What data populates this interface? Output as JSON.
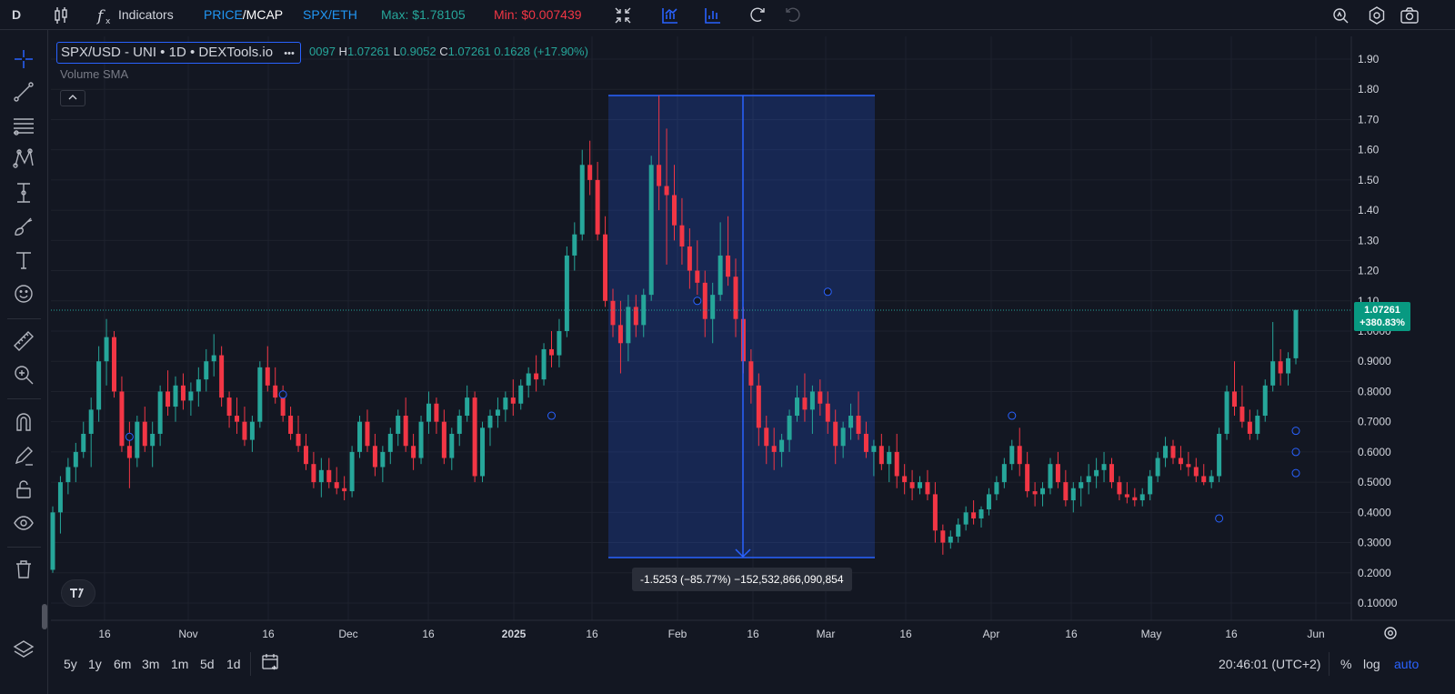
{
  "topbar": {
    "symbol_short": "D",
    "indicators_label": "Indicators",
    "price_label": "PRICE",
    "mcap_label": "/MCAP",
    "pair_label": "SPX/ETH",
    "max_label": "Max: $1.78105",
    "min_label": "Min: $0.007439"
  },
  "legend": {
    "title": "SPX/USD - UNI • 1D • DEXTools.io",
    "more": "•••",
    "ohlc_partial": "0097",
    "h_label": "H",
    "h_value": "1.07261",
    "l_label": "L",
    "l_value": "0.9052",
    "c_label": "C",
    "c_value": "1.07261",
    "change": "0.1628 (+17.90%)",
    "volume_label": "Volume SMA"
  },
  "price_axis": {
    "ticks": [
      "1.90",
      "1.80",
      "1.70",
      "1.60",
      "1.50",
      "1.40",
      "1.30",
      "1.20",
      "1.10",
      "1.0000",
      "0.9000",
      "0.8000",
      "0.7000",
      "0.6000",
      "0.5000",
      "0.4000",
      "0.3000",
      "0.2000",
      "0.10000"
    ],
    "last_price": "1.07261",
    "last_change": "+380.83%"
  },
  "time_axis": {
    "ticks": [
      "16",
      "Nov",
      "16",
      "Dec",
      "16",
      "2025",
      "16",
      "Feb",
      "16",
      "Mar",
      "16",
      "Apr",
      "16",
      "May",
      "16",
      "Jun"
    ]
  },
  "measure": {
    "label": "-1.5253 (−85.77%) −152,532,866,090,854"
  },
  "bottombar": {
    "ranges": [
      "5y",
      "1y",
      "6m",
      "3m",
      "1m",
      "5d",
      "1d"
    ],
    "clock": "20:46:01 (UTC+2)",
    "percent": "%",
    "log": "log",
    "auto": "auto"
  },
  "colors": {
    "up": "#26a69a",
    "down": "#f23645",
    "accent": "#2962ff",
    "background": "#131722"
  },
  "chart_data": {
    "type": "candlestick",
    "title": "SPX/USD - UNI • 1D • DEXTools.io",
    "x_range": [
      "2024-10-10",
      "2025-05-28"
    ],
    "y_range": [
      0.05,
      1.95
    ],
    "last_close": 1.07261,
    "measure": {
      "from": 1.78105,
      "to": 0.2557,
      "change": -1.5253,
      "change_pct": -85.77
    },
    "ohlc": [
      [
        0.21,
        0.42,
        0.2,
        0.4
      ],
      [
        0.4,
        0.52,
        0.33,
        0.5
      ],
      [
        0.5,
        0.58,
        0.46,
        0.55
      ],
      [
        0.55,
        0.63,
        0.5,
        0.6
      ],
      [
        0.6,
        0.7,
        0.58,
        0.66
      ],
      [
        0.66,
        0.78,
        0.55,
        0.74
      ],
      [
        0.74,
        0.95,
        0.7,
        0.9
      ],
      [
        0.9,
        1.04,
        0.82,
        0.98
      ],
      [
        0.98,
        1.0,
        0.78,
        0.8
      ],
      [
        0.8,
        0.85,
        0.6,
        0.62
      ],
      [
        0.62,
        0.7,
        0.48,
        0.58
      ],
      [
        0.58,
        0.72,
        0.55,
        0.7
      ],
      [
        0.7,
        0.75,
        0.6,
        0.62
      ],
      [
        0.62,
        0.7,
        0.55,
        0.66
      ],
      [
        0.66,
        0.82,
        0.62,
        0.8
      ],
      [
        0.8,
        0.87,
        0.72,
        0.75
      ],
      [
        0.75,
        0.85,
        0.7,
        0.82
      ],
      [
        0.82,
        0.86,
        0.74,
        0.77
      ],
      [
        0.77,
        0.83,
        0.72,
        0.8
      ],
      [
        0.8,
        0.88,
        0.75,
        0.84
      ],
      [
        0.84,
        0.94,
        0.8,
        0.9
      ],
      [
        0.9,
        0.99,
        0.85,
        0.92
      ],
      [
        0.92,
        0.95,
        0.75,
        0.78
      ],
      [
        0.78,
        0.8,
        0.68,
        0.72
      ],
      [
        0.72,
        0.78,
        0.66,
        0.7
      ],
      [
        0.7,
        0.75,
        0.62,
        0.64
      ],
      [
        0.64,
        0.72,
        0.6,
        0.7
      ],
      [
        0.7,
        0.9,
        0.68,
        0.88
      ],
      [
        0.88,
        0.95,
        0.8,
        0.82
      ],
      [
        0.82,
        0.88,
        0.76,
        0.78
      ],
      [
        0.78,
        0.82,
        0.7,
        0.72
      ],
      [
        0.72,
        0.75,
        0.64,
        0.66
      ],
      [
        0.66,
        0.72,
        0.6,
        0.62
      ],
      [
        0.62,
        0.66,
        0.54,
        0.56
      ],
      [
        0.56,
        0.6,
        0.48,
        0.5
      ],
      [
        0.5,
        0.58,
        0.45,
        0.54
      ],
      [
        0.54,
        0.58,
        0.48,
        0.5
      ],
      [
        0.5,
        0.55,
        0.46,
        0.48
      ],
      [
        0.48,
        0.52,
        0.44,
        0.47
      ],
      [
        0.47,
        0.62,
        0.45,
        0.6
      ],
      [
        0.6,
        0.72,
        0.58,
        0.7
      ],
      [
        0.7,
        0.74,
        0.6,
        0.62
      ],
      [
        0.62,
        0.66,
        0.52,
        0.55
      ],
      [
        0.55,
        0.62,
        0.5,
        0.6
      ],
      [
        0.6,
        0.68,
        0.56,
        0.66
      ],
      [
        0.66,
        0.74,
        0.62,
        0.72
      ],
      [
        0.72,
        0.78,
        0.6,
        0.62
      ],
      [
        0.62,
        0.66,
        0.54,
        0.58
      ],
      [
        0.58,
        0.72,
        0.56,
        0.7
      ],
      [
        0.7,
        0.8,
        0.66,
        0.76
      ],
      [
        0.76,
        0.78,
        0.66,
        0.7
      ],
      [
        0.7,
        0.74,
        0.56,
        0.58
      ],
      [
        0.58,
        0.68,
        0.54,
        0.66
      ],
      [
        0.66,
        0.74,
        0.62,
        0.72
      ],
      [
        0.72,
        0.82,
        0.7,
        0.78
      ],
      [
        0.78,
        0.8,
        0.5,
        0.52
      ],
      [
        0.52,
        0.7,
        0.5,
        0.68
      ],
      [
        0.68,
        0.74,
        0.62,
        0.72
      ],
      [
        0.72,
        0.78,
        0.68,
        0.74
      ],
      [
        0.74,
        0.8,
        0.7,
        0.78
      ],
      [
        0.78,
        0.84,
        0.72,
        0.76
      ],
      [
        0.76,
        0.84,
        0.74,
        0.82
      ],
      [
        0.82,
        0.88,
        0.78,
        0.86
      ],
      [
        0.86,
        0.92,
        0.8,
        0.84
      ],
      [
        0.84,
        0.96,
        0.82,
        0.94
      ],
      [
        0.94,
        1.0,
        0.88,
        0.92
      ],
      [
        0.92,
        1.04,
        0.88,
        1.0
      ],
      [
        1.0,
        1.28,
        0.98,
        1.25
      ],
      [
        1.25,
        1.36,
        1.2,
        1.32
      ],
      [
        1.32,
        1.6,
        1.3,
        1.55
      ],
      [
        1.55,
        1.63,
        1.45,
        1.5
      ],
      [
        1.5,
        1.56,
        1.3,
        1.32
      ],
      [
        1.32,
        1.38,
        1.08,
        1.1
      ],
      [
        1.1,
        1.14,
        0.98,
        1.02
      ],
      [
        1.02,
        1.1,
        0.86,
        0.96
      ],
      [
        0.96,
        1.12,
        0.9,
        1.08
      ],
      [
        1.08,
        1.12,
        0.98,
        1.02
      ],
      [
        1.02,
        1.14,
        0.98,
        1.12
      ],
      [
        1.12,
        1.58,
        1.1,
        1.55
      ],
      [
        1.55,
        1.78,
        1.4,
        1.48
      ],
      [
        1.48,
        1.67,
        1.22,
        1.45
      ],
      [
        1.45,
        1.55,
        1.3,
        1.35
      ],
      [
        1.35,
        1.44,
        1.22,
        1.28
      ],
      [
        1.28,
        1.34,
        1.14,
        1.2
      ],
      [
        1.2,
        1.3,
        1.12,
        1.16
      ],
      [
        1.16,
        1.2,
        0.98,
        1.04
      ],
      [
        1.04,
        1.16,
        0.96,
        1.12
      ],
      [
        1.12,
        1.36,
        1.1,
        1.25
      ],
      [
        1.25,
        1.38,
        1.15,
        1.18
      ],
      [
        1.18,
        1.24,
        0.98,
        1.04
      ],
      [
        1.04,
        1.08,
        0.86,
        0.9
      ],
      [
        0.9,
        0.94,
        0.76,
        0.82
      ],
      [
        0.82,
        0.86,
        0.62,
        0.68
      ],
      [
        0.68,
        0.72,
        0.56,
        0.62
      ],
      [
        0.62,
        0.68,
        0.54,
        0.6
      ],
      [
        0.6,
        0.66,
        0.55,
        0.64
      ],
      [
        0.64,
        0.74,
        0.6,
        0.72
      ],
      [
        0.72,
        0.82,
        0.7,
        0.78
      ],
      [
        0.78,
        0.86,
        0.7,
        0.74
      ],
      [
        0.74,
        0.82,
        0.66,
        0.8
      ],
      [
        0.8,
        0.84,
        0.72,
        0.76
      ],
      [
        0.76,
        0.8,
        0.66,
        0.7
      ],
      [
        0.7,
        0.74,
        0.56,
        0.62
      ],
      [
        0.62,
        0.7,
        0.58,
        0.68
      ],
      [
        0.68,
        0.76,
        0.64,
        0.72
      ],
      [
        0.72,
        0.8,
        0.64,
        0.66
      ],
      [
        0.66,
        0.7,
        0.58,
        0.6
      ],
      [
        0.6,
        0.64,
        0.52,
        0.62
      ],
      [
        0.62,
        0.66,
        0.54,
        0.56
      ],
      [
        0.56,
        0.62,
        0.5,
        0.6
      ],
      [
        0.6,
        0.66,
        0.48,
        0.52
      ],
      [
        0.52,
        0.56,
        0.46,
        0.5
      ],
      [
        0.5,
        0.54,
        0.44,
        0.48
      ],
      [
        0.48,
        0.52,
        0.46,
        0.5
      ],
      [
        0.5,
        0.54,
        0.44,
        0.46
      ],
      [
        0.46,
        0.5,
        0.3,
        0.34
      ],
      [
        0.34,
        0.36,
        0.26,
        0.3
      ],
      [
        0.3,
        0.34,
        0.28,
        0.32
      ],
      [
        0.32,
        0.38,
        0.3,
        0.36
      ],
      [
        0.36,
        0.42,
        0.34,
        0.4
      ],
      [
        0.4,
        0.44,
        0.36,
        0.38
      ],
      [
        0.38,
        0.42,
        0.35,
        0.41
      ],
      [
        0.41,
        0.48,
        0.39,
        0.46
      ],
      [
        0.46,
        0.52,
        0.44,
        0.5
      ],
      [
        0.5,
        0.58,
        0.48,
        0.56
      ],
      [
        0.56,
        0.64,
        0.54,
        0.62
      ],
      [
        0.62,
        0.68,
        0.52,
        0.56
      ],
      [
        0.56,
        0.6,
        0.45,
        0.47
      ],
      [
        0.47,
        0.5,
        0.42,
        0.46
      ],
      [
        0.46,
        0.5,
        0.42,
        0.48
      ],
      [
        0.48,
        0.58,
        0.46,
        0.56
      ],
      [
        0.56,
        0.6,
        0.48,
        0.5
      ],
      [
        0.5,
        0.54,
        0.42,
        0.44
      ],
      [
        0.44,
        0.5,
        0.4,
        0.48
      ],
      [
        0.48,
        0.52,
        0.42,
        0.5
      ],
      [
        0.5,
        0.56,
        0.46,
        0.52
      ],
      [
        0.52,
        0.58,
        0.48,
        0.54
      ],
      [
        0.54,
        0.6,
        0.5,
        0.56
      ],
      [
        0.56,
        0.58,
        0.48,
        0.5
      ],
      [
        0.5,
        0.52,
        0.44,
        0.46
      ],
      [
        0.46,
        0.5,
        0.43,
        0.45
      ],
      [
        0.45,
        0.48,
        0.42,
        0.44
      ],
      [
        0.44,
        0.48,
        0.42,
        0.46
      ],
      [
        0.46,
        0.54,
        0.44,
        0.52
      ],
      [
        0.52,
        0.6,
        0.5,
        0.58
      ],
      [
        0.58,
        0.65,
        0.55,
        0.62
      ],
      [
        0.62,
        0.64,
        0.56,
        0.58
      ],
      [
        0.58,
        0.62,
        0.54,
        0.56
      ],
      [
        0.56,
        0.6,
        0.52,
        0.55
      ],
      [
        0.55,
        0.58,
        0.5,
        0.52
      ],
      [
        0.52,
        0.56,
        0.49,
        0.5
      ],
      [
        0.5,
        0.54,
        0.48,
        0.52
      ],
      [
        0.52,
        0.68,
        0.5,
        0.66
      ],
      [
        0.66,
        0.82,
        0.64,
        0.8
      ],
      [
        0.8,
        0.9,
        0.72,
        0.75
      ],
      [
        0.75,
        0.82,
        0.68,
        0.7
      ],
      [
        0.7,
        0.74,
        0.64,
        0.66
      ],
      [
        0.66,
        0.74,
        0.64,
        0.72
      ],
      [
        0.72,
        0.84,
        0.7,
        0.82
      ],
      [
        0.82,
        1.03,
        0.8,
        0.9
      ],
      [
        0.9,
        0.94,
        0.82,
        0.86
      ],
      [
        0.86,
        0.93,
        0.82,
        0.91
      ],
      [
        0.91,
        1.07,
        0.89,
        1.07
      ]
    ]
  }
}
